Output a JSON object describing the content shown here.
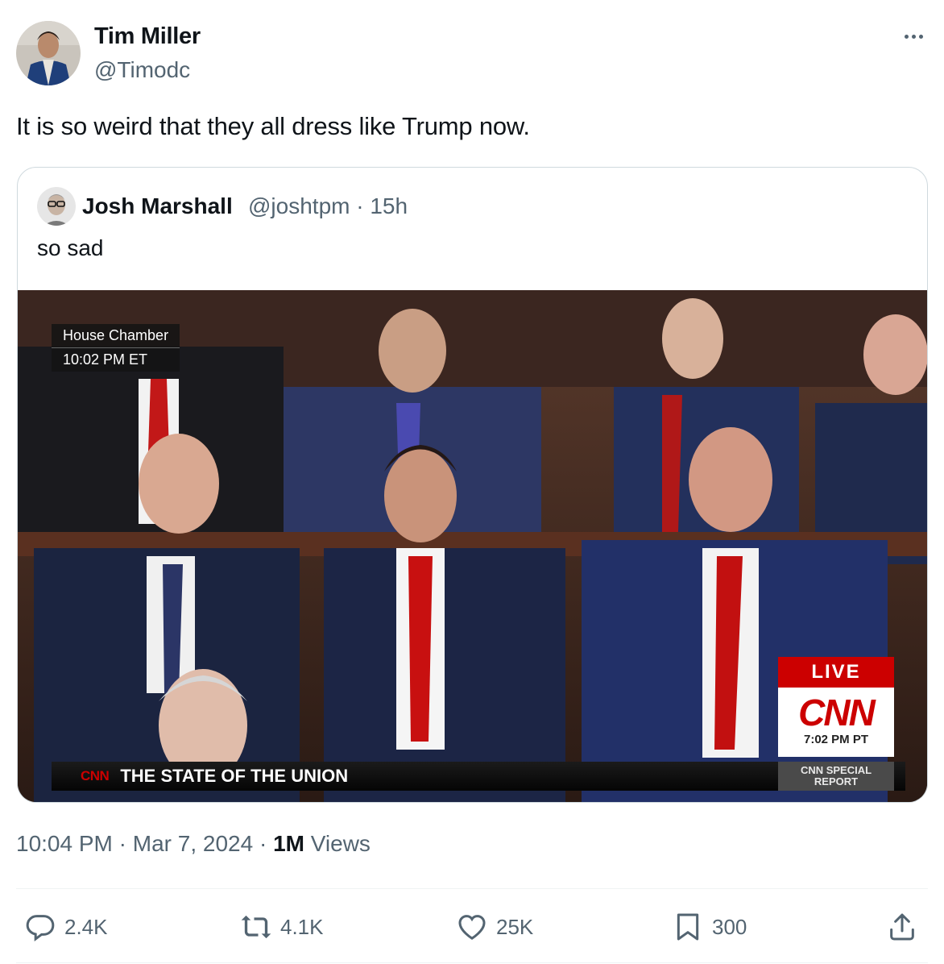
{
  "author": {
    "name": "Tim Miller",
    "handle": "@Timodc"
  },
  "tweet": {
    "text": "It is so weird that they all dress like Trump now."
  },
  "quote": {
    "name": "Josh Marshall",
    "handle_time": "@joshtpm · 15h",
    "text": "so sad",
    "media": {
      "location_label": "House Chamber",
      "location_time": "10:02 PM ET",
      "chyron_logo": "CNN",
      "chyron_text": "THE STATE OF THE UNION",
      "live_label": "LIVE",
      "live_logo": "CNN",
      "live_time": "7:02 PM PT",
      "special_line1": "CNN SPECIAL",
      "special_line2": "REPORT"
    }
  },
  "meta": {
    "time": "10:04 PM",
    "date": "Mar 7, 2024",
    "views_count": "1M",
    "views_label": "Views"
  },
  "actions": {
    "replies": "2.4K",
    "reposts": "4.1K",
    "likes": "25K",
    "bookmarks": "300"
  },
  "icons": [
    "more-icon",
    "reply-icon",
    "repost-icon",
    "like-icon",
    "bookmark-icon",
    "share-icon"
  ],
  "colors": {
    "text_primary": "#0f1419",
    "text_secondary": "#536471",
    "border": "#cfd9de",
    "cnn_red": "#cc0000"
  }
}
